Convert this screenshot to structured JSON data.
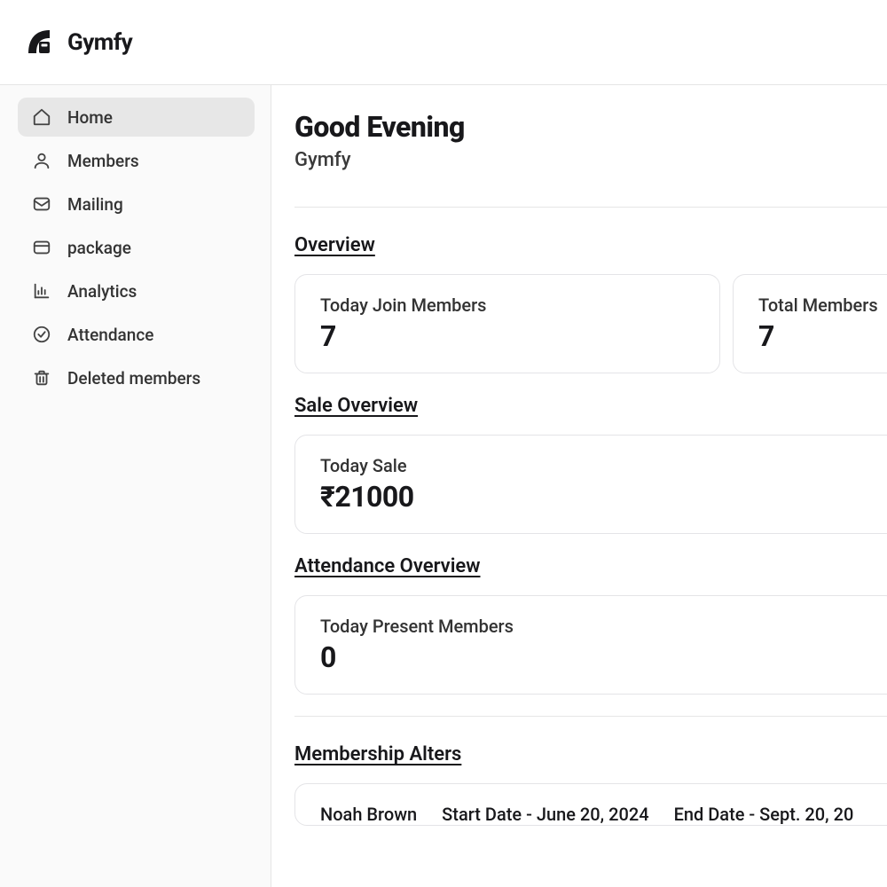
{
  "brand": "Gymfy",
  "sidebar": {
    "items": [
      {
        "label": "Home",
        "icon": "home",
        "active": true
      },
      {
        "label": "Members",
        "icon": "user",
        "active": false
      },
      {
        "label": "Mailing",
        "icon": "mail",
        "active": false
      },
      {
        "label": "package",
        "icon": "package",
        "active": false
      },
      {
        "label": "Analytics",
        "icon": "analytics",
        "active": false
      },
      {
        "label": "Attendance",
        "icon": "attendance",
        "active": false
      },
      {
        "label": "Deleted members",
        "icon": "trash",
        "active": false
      }
    ]
  },
  "greeting": "Good Evening",
  "subtitle": "Gymfy",
  "sections": {
    "overview": {
      "title": "Overview",
      "cards": [
        {
          "label": "Today Join Members",
          "value": "7"
        },
        {
          "label": "Total Members",
          "value": "7"
        }
      ]
    },
    "sale": {
      "title": "Sale Overview",
      "cards": [
        {
          "label": "Today Sale",
          "value": "₹21000"
        }
      ]
    },
    "attendance": {
      "title": "Attendance Overview",
      "cards": [
        {
          "label": "Today Present Members",
          "value": "0"
        }
      ]
    },
    "alters": {
      "title": "Membership Alters",
      "row": {
        "name": "Noah Brown",
        "start": "Start Date - June 20, 2024",
        "end": "End Date - Sept. 20, 20"
      }
    }
  }
}
